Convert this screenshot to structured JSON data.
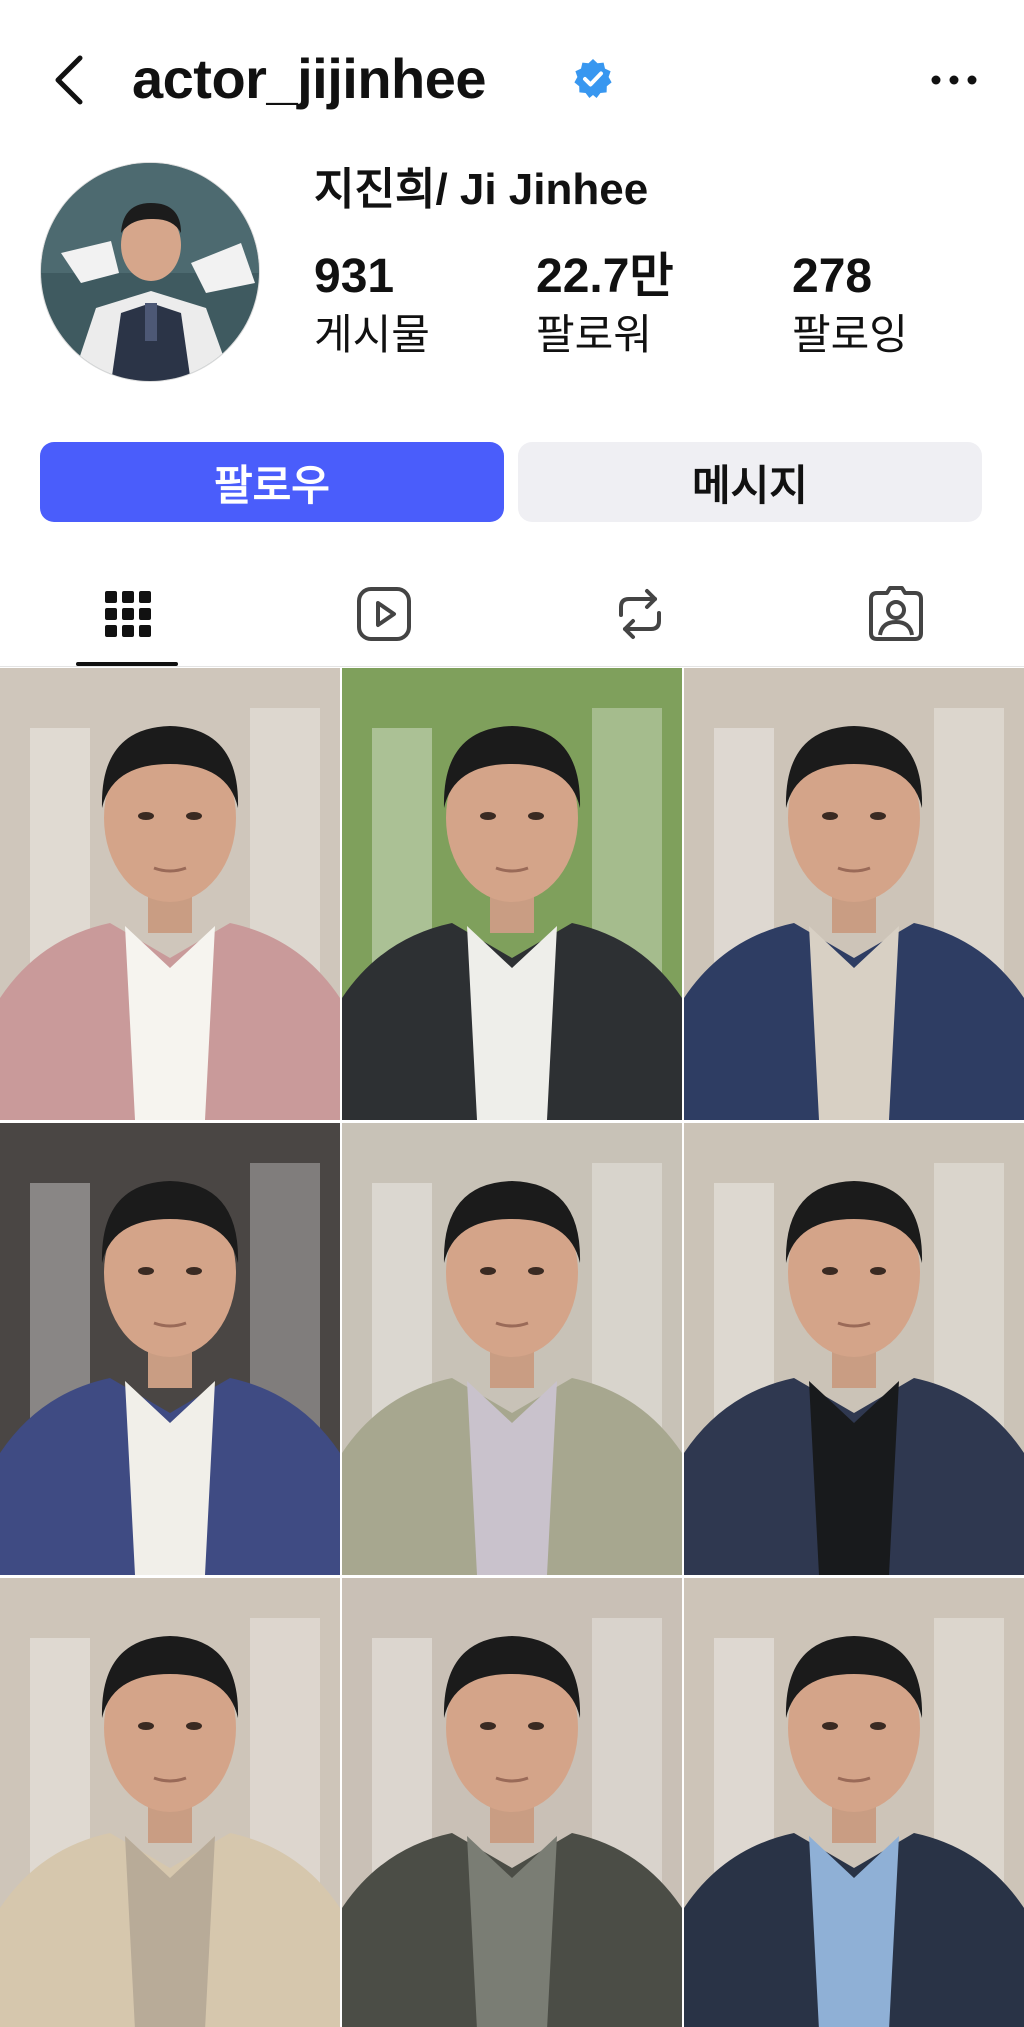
{
  "header": {
    "username": "actor_jijinhee",
    "verified": true,
    "back_icon": "chevron-left-icon",
    "more_icon": "more-horizontal-icon",
    "verified_color": "#3897f0"
  },
  "profile": {
    "full_name": "지진희/ Ji Jinhee",
    "stats": {
      "posts": {
        "value": "931",
        "label": "게시물"
      },
      "followers": {
        "value": "22.7만",
        "label": "팔로워"
      },
      "following": {
        "value": "278",
        "label": "팔로잉"
      }
    }
  },
  "actions": {
    "follow_label": "팔로우",
    "message_label": "메시지",
    "follow_color": "#4a5dfb",
    "message_color": "#efeff3"
  },
  "tabs": [
    {
      "icon": "grid-icon",
      "selected": true
    },
    {
      "icon": "reels-icon",
      "selected": false
    },
    {
      "icon": "repost-icon",
      "selected": false
    },
    {
      "icon": "tagged-icon",
      "selected": false
    }
  ],
  "grid_posts": [
    {
      "outfit": "pink plaid blazer, white shirt",
      "jacket_color": "#c99a9a",
      "inner_color": "#f6f4ef",
      "bg_color": "#cfc6bb"
    },
    {
      "outfit": "dark jacket, white t-shirt",
      "jacket_color": "#2d3033",
      "inner_color": "#eeeeea",
      "bg_color": "#7fa05c"
    },
    {
      "outfit": "navy blazer, beige t-shirt",
      "jacket_color": "#2e3d63",
      "inner_color": "#d8d0c4",
      "bg_color": "#cdc4b8"
    },
    {
      "outfit": "blue hanbok",
      "jacket_color": "#3f4b83",
      "inner_color": "#f1efe9",
      "bg_color": "#4a4644"
    },
    {
      "outfit": "olive suit, lavender shirt",
      "jacket_color": "#a7a78f",
      "inner_color": "#c9c2cc",
      "bg_color": "#c8c2b7"
    },
    {
      "outfit": "navy blazer, black t-shirt",
      "jacket_color": "#2f3850",
      "inner_color": "#181a1c",
      "bg_color": "#cbc3b7"
    },
    {
      "outfit": "beige shirt jacket",
      "jacket_color": "#d6c7ad",
      "inner_color": "#b8ab98",
      "bg_color": "#cec5b9"
    },
    {
      "outfit": "dark olive jacket",
      "jacket_color": "#4b4d46",
      "inner_color": "#7a7d74",
      "bg_color": "#c9c0b6"
    },
    {
      "outfit": "navy jacket, blue shirt",
      "jacket_color": "#293346",
      "inner_color": "#8fb0d6",
      "bg_color": "#cdc4b8"
    }
  ]
}
